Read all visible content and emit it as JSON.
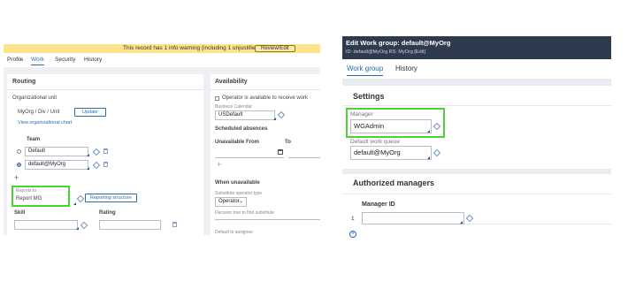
{
  "left": {
    "warning_text": "This record has 1 info warning (including 1 unjustified)",
    "review_button": "Review/Edit",
    "tabs": [
      "Profile",
      "Work",
      "Security",
      "History"
    ],
    "routing": {
      "title": "Routing",
      "org_unit_label": "Organizational unit",
      "org_unit_path": "MyOrg  / Div  / Unit",
      "update_button": "Update",
      "view_chart_link": "View organizational chart",
      "team_header": "Team",
      "teams": [
        "Default",
        "default@MyOrg"
      ],
      "reports_to_label": "Reports to",
      "reports_to_value": "Report MG",
      "reporting_structure_button": "Reporting structure",
      "skill_header": "Skill",
      "rating_header": "Rating"
    },
    "availability": {
      "title": "Availability",
      "operator_available": "Operator is available to receive work",
      "business_calendar_label": "Business Calendar",
      "business_calendar_value": "USDefault",
      "scheduled_absences": "Scheduled absences",
      "unavailable_from": "Unavailable From",
      "to": "To",
      "when_unavailable": "When unavailable",
      "substitute_type_label": "Substitute operator type",
      "substitute_type_value": "Operator",
      "decision_tree_label": "Decision tree to find substitute",
      "default_to_assignee_label": "Default to assignee"
    }
  },
  "right": {
    "header_title": "Edit  Work group: default@MyOrg",
    "header_sub": "ID:  default@MyOrg   RS:  MyOrg   [Edit]",
    "tabs": [
      "Work group",
      "History"
    ],
    "settings_title": "Settings",
    "manager_label": "Manager",
    "manager_value": "WGAdmin",
    "default_queue_label": "Default work queue",
    "default_queue_value": "default@MyOrg",
    "authorized_title": "Authorized managers",
    "manager_id_header": "Manager ID",
    "row_number": "1"
  },
  "colors": {
    "warning": "#fde48a",
    "accent": "#2b6cb0",
    "highlight": "#4cd137",
    "header_dark": "#2e3a4d"
  }
}
